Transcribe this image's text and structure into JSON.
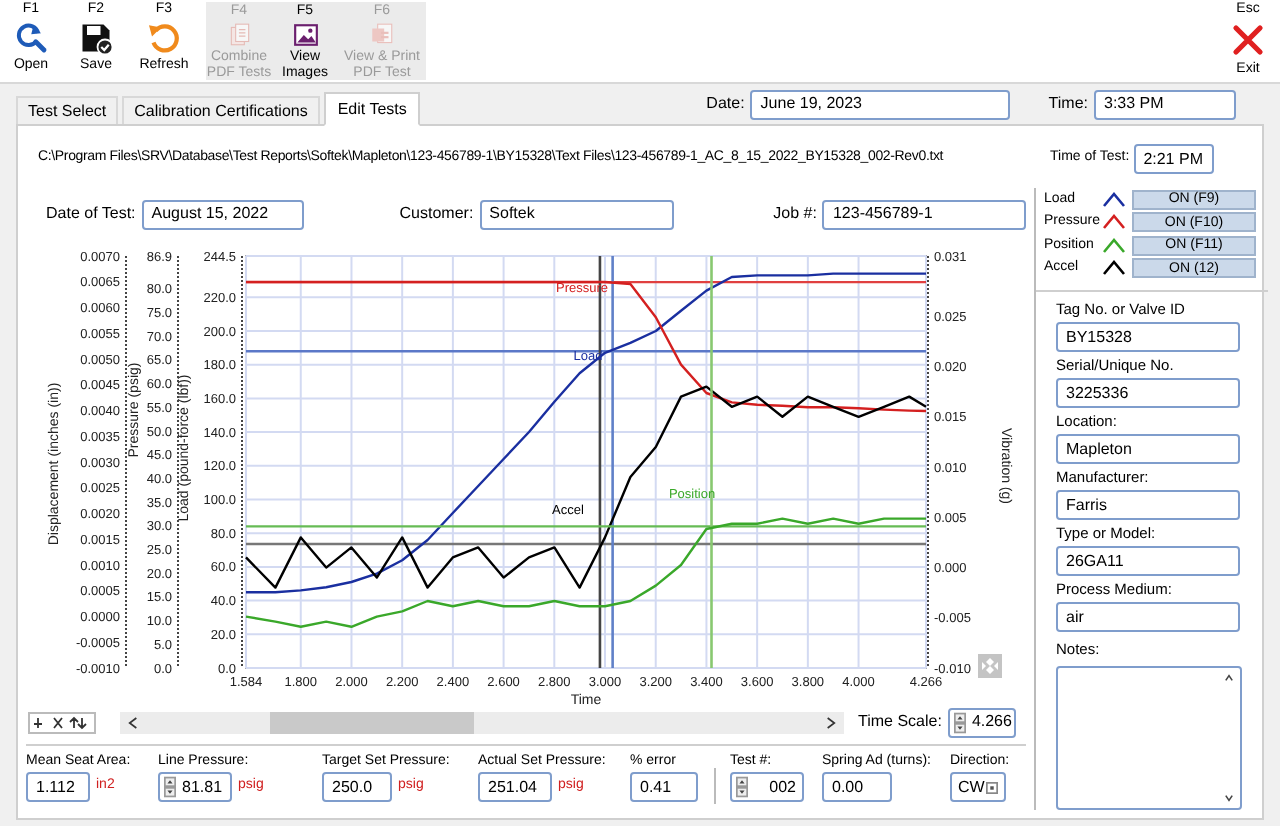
{
  "toolbar": {
    "buttons": [
      {
        "key": "F1",
        "label": "Open",
        "kind": "open",
        "disabled": false
      },
      {
        "key": "F2",
        "label": "Save",
        "kind": "save",
        "disabled": false
      },
      {
        "key": "F3",
        "label": "Refresh",
        "kind": "refresh",
        "disabled": false
      },
      {
        "key": "F4",
        "label": "Combine PDF Tests",
        "kind": "combine",
        "disabled": true
      },
      {
        "key": "F5",
        "label": "View Images",
        "kind": "images",
        "disabled": false
      },
      {
        "key": "F6",
        "label": "View & Print PDF Test",
        "kind": "print",
        "disabled": true
      }
    ],
    "exit": {
      "key": "Esc",
      "label": "Exit"
    }
  },
  "tabs": [
    {
      "label": "Test Select",
      "selected": false
    },
    {
      "label": "Calibration Certifications",
      "selected": false
    },
    {
      "label": "Edit Tests",
      "selected": true
    }
  ],
  "date": {
    "label": "Date:",
    "value": "June 19, 2023"
  },
  "time": {
    "label": "Time:",
    "value": "3:33 PM"
  },
  "file_path": "C:\\Program Files\\SRV\\Database\\Test Reports\\Softek\\Mapleton\\123-456789-1\\BY15328\\Text Files\\123-456789-1_AC_8_15_2022_BY15328_002-Rev0.txt",
  "time_of_test": {
    "label": "Time of Test:",
    "value": "2:21 PM"
  },
  "test_info": [
    {
      "label": "Date of Test:",
      "value": "August 15, 2022"
    },
    {
      "label": "Customer:",
      "value": "Softek"
    },
    {
      "label": "Job #:",
      "value": "123-456789-1"
    }
  ],
  "main_chart": {
    "chart_data": {
      "type": "line",
      "xlabel": "Time",
      "ylabel": "Load (pound-force (lbf))",
      "y2label": "Vibration (g)",
      "y3label": "Pressure (psig)",
      "xlim": [
        1.584,
        4.266
      ],
      "x": [
        1.584,
        1.7,
        1.8,
        1.9,
        2.0,
        2.1,
        2.2,
        2.3,
        2.4,
        2.5,
        2.6,
        2.7,
        2.8,
        2.9,
        3.0,
        3.1,
        3.2,
        3.3,
        3.4,
        3.5,
        3.6,
        3.7,
        3.8,
        3.9,
        4.0,
        4.1,
        4.2,
        4.266
      ],
      "xticks": [
        {
          "value": 1.584,
          "label": "1.584"
        },
        {
          "value": 1.8,
          "label": "1.800"
        },
        {
          "value": 2.0,
          "label": "2.000"
        },
        {
          "value": 2.2,
          "label": "2.200"
        },
        {
          "value": 2.4,
          "label": "2.400"
        },
        {
          "value": 2.6,
          "label": "2.600"
        },
        {
          "value": 2.8,
          "label": "2.800"
        },
        {
          "value": 3.0,
          "label": "3.000"
        },
        {
          "value": 3.2,
          "label": "3.200"
        },
        {
          "value": 3.4,
          "label": "3.400"
        },
        {
          "value": 3.6,
          "label": "3.600"
        },
        {
          "value": 3.8,
          "label": "3.800"
        },
        {
          "value": 4.0,
          "label": "4.000"
        },
        {
          "value": 4.266,
          "label": "4.266"
        }
      ],
      "ylim": [
        0,
        244.5
      ],
      "yticks": [
        {
          "value": 244.5,
          "label": "244.5"
        },
        {
          "value": 220,
          "label": "220.0"
        },
        {
          "value": 200,
          "label": "200.0"
        },
        {
          "value": 180,
          "label": "180.0"
        },
        {
          "value": 160,
          "label": "160.0"
        },
        {
          "value": 140,
          "label": "140.0"
        },
        {
          "value": 120,
          "label": "120.0"
        },
        {
          "value": 100,
          "label": "100.0"
        },
        {
          "value": 80,
          "label": "80.0"
        },
        {
          "value": 60,
          "label": "60.0"
        },
        {
          "value": 40,
          "label": "40.0"
        },
        {
          "value": 20,
          "label": "20.0"
        },
        {
          "value": 0,
          "label": "0.0"
        }
      ],
      "y2lim": [
        -0.01,
        0.031
      ],
      "y2ticks": [
        {
          "value": 0.031,
          "label": "0.031"
        },
        {
          "value": 0.025,
          "label": "0.025"
        },
        {
          "value": 0.02,
          "label": "0.020"
        },
        {
          "value": 0.015,
          "label": "0.015"
        },
        {
          "value": 0.01,
          "label": "0.010"
        },
        {
          "value": 0.005,
          "label": "0.005"
        },
        {
          "value": 0,
          "label": "0.000"
        },
        {
          "value": -0.005,
          "label": "-0.005"
        },
        {
          "value": -0.01,
          "label": "-0.010"
        }
      ],
      "y3lim": [
        0,
        86.9
      ],
      "y3ticks": [
        {
          "value": 86.9,
          "label": "86.9"
        },
        {
          "value": 80,
          "label": "80.0"
        },
        {
          "value": 75,
          "label": "75.0"
        },
        {
          "value": 70,
          "label": "70.0"
        },
        {
          "value": 65,
          "label": "65.0"
        },
        {
          "value": 60,
          "label": "60.0"
        },
        {
          "value": 55,
          "label": "55.0"
        },
        {
          "value": 50,
          "label": "50.0"
        },
        {
          "value": 45,
          "label": "45.0"
        },
        {
          "value": 40,
          "label": "40.0"
        },
        {
          "value": 35,
          "label": "35.0"
        },
        {
          "value": 30,
          "label": "30.0"
        },
        {
          "value": 25,
          "label": "25.0"
        },
        {
          "value": 20,
          "label": "20.0"
        },
        {
          "value": 15,
          "label": "15.0"
        },
        {
          "value": 10,
          "label": "10.0"
        },
        {
          "value": 5,
          "label": "5.0"
        },
        {
          "value": 0,
          "label": "0.0"
        }
      ],
      "series": [
        {
          "name": "Load",
          "color": "#1a2fa0",
          "values": [
            45,
            45,
            46,
            48,
            51,
            56,
            64,
            76,
            92,
            108,
            124,
            140,
            158,
            175,
            187,
            193,
            200,
            212,
            224,
            232,
            233,
            233,
            233,
            234,
            234,
            234,
            234,
            234
          ]
        },
        {
          "name": "Pressure",
          "axis": "y3",
          "color": "#d42020",
          "values": [
            81.4,
            81.4,
            81.4,
            81.4,
            81.4,
            81.4,
            81.4,
            81.4,
            81.4,
            81.4,
            81.4,
            81.4,
            81.4,
            81.4,
            81.4,
            81.0,
            74,
            64,
            58,
            56,
            55.5,
            55.3,
            55,
            55,
            54.8,
            54.5,
            54.3,
            54.2
          ]
        },
        {
          "name": "Accel",
          "axis": "y2",
          "color": "#000000",
          "values": [
            0.001,
            -0.002,
            0.003,
            0.0,
            0.002,
            -0.001,
            0.003,
            -0.002,
            0.001,
            0.002,
            -0.001,
            0.001,
            0.002,
            -0.002,
            0.003,
            0.009,
            0.012,
            0.017,
            0.018,
            0.016,
            0.017,
            0.015,
            0.017,
            0.016,
            0.015,
            0.016,
            0.017,
            0.016
          ]
        }
      ],
      "grid": true,
      "ref_lines": [
        {
          "axis": "y",
          "value": 229,
          "color": "#e04040"
        },
        {
          "axis": "y",
          "value": 188,
          "color": "#5b78c8"
        },
        {
          "axis": "y",
          "value": 73.6,
          "color": "#777777"
        },
        {
          "axis": "x",
          "value": 2.98,
          "color": "#444444"
        },
        {
          "axis": "x",
          "value": 3.03,
          "color": "#6080c8"
        }
      ]
    },
    "trace_labels": [
      "Load",
      "Pressure",
      "Position",
      "Accel"
    ]
  },
  "displacement_chart": {
    "chart_data": {
      "type": "line",
      "ylabel": "Displacement (inches (in))",
      "xlim": [
        1.584,
        4.266
      ],
      "x": [
        1.584,
        1.7,
        1.8,
        1.9,
        2.0,
        2.1,
        2.2,
        2.3,
        2.4,
        2.5,
        2.6,
        2.7,
        2.8,
        2.9,
        3.0,
        3.1,
        3.2,
        3.3,
        3.4,
        3.5,
        3.6,
        3.7,
        3.8,
        3.9,
        4.0,
        4.1,
        4.2,
        4.266
      ],
      "ylim": [
        -0.001,
        0.007
      ],
      "yticks": [
        {
          "value": 0.007,
          "label": "0.0070"
        },
        {
          "value": 0.0065,
          "label": "0.0065"
        },
        {
          "value": 0.006,
          "label": "0.0060"
        },
        {
          "value": 0.0055,
          "label": "0.0055"
        },
        {
          "value": 0.005,
          "label": "0.0050"
        },
        {
          "value": 0.0045,
          "label": "0.0045"
        },
        {
          "value": 0.004,
          "label": "0.0040"
        },
        {
          "value": 0.0035,
          "label": "0.0035"
        },
        {
          "value": 0.003,
          "label": "0.0030"
        },
        {
          "value": 0.0025,
          "label": "0.0025"
        },
        {
          "value": 0.002,
          "label": "0.0020"
        },
        {
          "value": 0.0015,
          "label": "0.0015"
        },
        {
          "value": 0.001,
          "label": "0.0010"
        },
        {
          "value": 0.0005,
          "label": "0.0005"
        },
        {
          "value": 0,
          "label": "0.0000"
        },
        {
          "value": -0.0005,
          "label": "-0.0005"
        },
        {
          "value": -0.001,
          "label": "-0.0010"
        }
      ],
      "series": [
        {
          "name": "Position",
          "color": "#3aa82a",
          "values": [
            0.0,
            -0.0001,
            -0.0002,
            -0.0001,
            -0.0002,
            0.0,
            0.0001,
            0.0003,
            0.0002,
            0.0003,
            0.0002,
            0.0002,
            0.0003,
            0.0002,
            0.0002,
            0.0003,
            0.0006,
            0.001,
            0.0017,
            0.0018,
            0.0018,
            0.0019,
            0.0018,
            0.0019,
            0.0018,
            0.0019,
            0.0019,
            0.0019
          ]
        }
      ],
      "ref_lines": [
        {
          "axis": "y",
          "value": 0.00175,
          "color": "#66bb55"
        },
        {
          "axis": "x",
          "value": 3.42,
          "color": "#88c870"
        }
      ]
    }
  },
  "time_scale": {
    "label": "Time Scale:",
    "value": "4.266"
  },
  "setpoint_fields": [
    {
      "kind": "text",
      "label": "Mean Seat Area:",
      "value": "1.112",
      "unit": "in2"
    },
    {
      "kind": "spinner",
      "label": "Line Pressure:",
      "value": "81.81",
      "unit": "psig"
    },
    {
      "kind": "text",
      "label": "Target Set Pressure:",
      "value": "250.0",
      "unit": "psig"
    },
    {
      "kind": "text",
      "label": "Actual Set Pressure:",
      "value": "251.04",
      "unit": "psig"
    },
    {
      "kind": "text",
      "label": "% error",
      "value": "0.41"
    }
  ],
  "test_fields": [
    {
      "kind": "spinner",
      "label": "Test #:",
      "value": "002"
    },
    {
      "kind": "text",
      "label": "Spring Ad (turns):",
      "value": "0.00"
    },
    {
      "kind": "dropdown",
      "label": "Direction:",
      "value": "CW"
    }
  ],
  "legend_buttons": [
    "ON (F9)",
    "ON (F10)",
    "ON (F11)",
    "ON (12)"
  ],
  "valve_fields": [
    {
      "label": "Tag No. or Valve ID",
      "value": "BY15328"
    },
    {
      "label": "Serial/Unique No.",
      "value": "3225336"
    },
    {
      "label": "Location:",
      "value": "Mapleton"
    },
    {
      "label": "Manufacturer:",
      "value": "Farris"
    },
    {
      "label": "Type or Model:",
      "value": "26GA11"
    },
    {
      "label": "Process Medium:",
      "value": "air"
    }
  ],
  "notes": {
    "label": "Notes:"
  }
}
